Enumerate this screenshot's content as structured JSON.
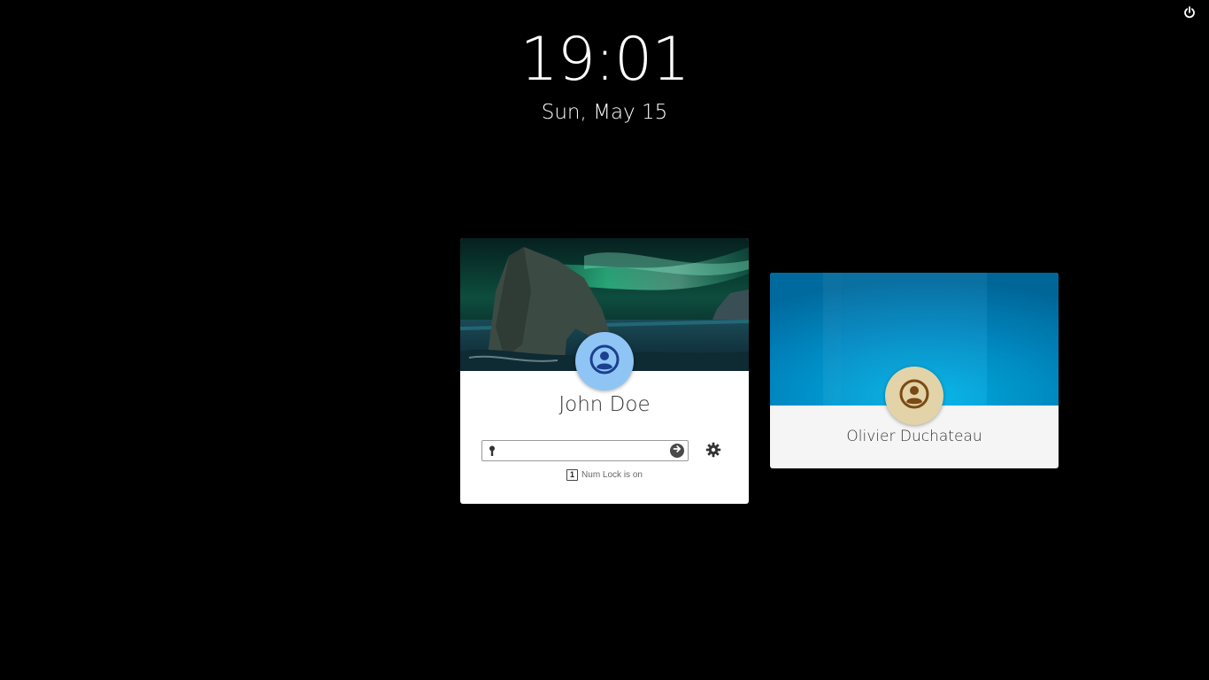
{
  "lockscreen": {
    "time": "19:01",
    "date": "Sun, May 15"
  },
  "icons": {
    "power": "power-icon",
    "key": "key-icon",
    "submit": "arrow-right-circle-icon",
    "settings": "gear-icon",
    "numlock": "numlock-icon",
    "avatar": "user-avatar-icon"
  },
  "users": [
    {
      "name": "John Doe",
      "password_value": "",
      "password_placeholder": "",
      "numlock_symbol": "1",
      "numlock_text": "Num Lock is on",
      "avatar_color": "#8ec5f5",
      "avatar_icon_color": "#1c3f8f"
    },
    {
      "name": "Olivier Duchateau",
      "avatar_color": "#e2d3a8",
      "avatar_icon_color": "#7a4a14"
    }
  ],
  "colors": {
    "background": "#000000",
    "card": "#ffffff",
    "card_inactive": "#f5f5f5",
    "text_dark": "#333333",
    "banner_blue": "#0096cc",
    "aurora_green": "#2fd39a"
  }
}
